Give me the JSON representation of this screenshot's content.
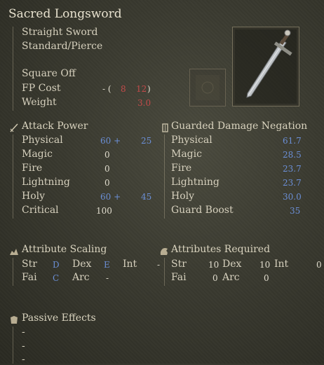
{
  "item": {
    "name": "Sacred Longsword",
    "type": "Straight Sword",
    "attack_type": "Standard/Pierce",
    "skill": "Square Off",
    "fp_label": "FP Cost",
    "fp_prefix": "- (",
    "fp_val1": "8",
    "fp_val2": "12",
    "fp_suffix": ")",
    "weight_label": "Weight",
    "weight_value": "3.0"
  },
  "attack": {
    "header": "Attack Power",
    "rows": [
      {
        "label": "Physical",
        "base": "60 +",
        "bonus": "25"
      },
      {
        "label": "Magic",
        "base": "0",
        "bonus": ""
      },
      {
        "label": "Fire",
        "base": "0",
        "bonus": ""
      },
      {
        "label": "Lightning",
        "base": "0",
        "bonus": ""
      },
      {
        "label": "Holy",
        "base": "60 +",
        "bonus": "45"
      },
      {
        "label": "Critical",
        "base": "100",
        "bonus": ""
      }
    ]
  },
  "guard": {
    "header": "Guarded Damage Negation",
    "rows": [
      {
        "label": "Physical",
        "value": "61.7"
      },
      {
        "label": "Magic",
        "value": "28.5"
      },
      {
        "label": "Fire",
        "value": "23.7"
      },
      {
        "label": "Lightning",
        "value": "23.7"
      },
      {
        "label": "Holy",
        "value": "30.0"
      },
      {
        "label": "Guard Boost",
        "value": "35"
      }
    ]
  },
  "scaling": {
    "header": "Attribute Scaling",
    "str_label": "Str",
    "str_val": "D",
    "dex_label": "Dex",
    "dex_val": "E",
    "int_label": "Int",
    "int_val": "-",
    "fai_label": "Fai",
    "fai_val": "C",
    "arc_label": "Arc",
    "arc_val": "-"
  },
  "required": {
    "header": "Attributes Required",
    "str_label": "Str",
    "str_val": "10",
    "dex_label": "Dex",
    "dex_val": "10",
    "int_label": "Int",
    "int_val": "0",
    "fai_label": "Fai",
    "fai_val": "0",
    "arc_label": "Arc",
    "arc_val": "0"
  },
  "passive": {
    "header": "Passive Effects",
    "items": [
      "-",
      "-",
      "-"
    ]
  }
}
